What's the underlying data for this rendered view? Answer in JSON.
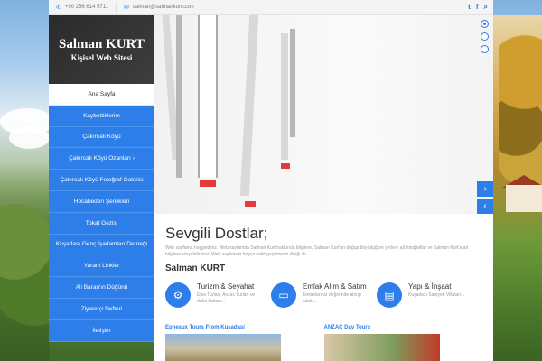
{
  "topbar": {
    "phone": "+90 256 614 5711",
    "email": "salman@salmankurt.com",
    "social_icons": [
      "twitter-icon",
      "facebook-icon",
      "search-icon"
    ]
  },
  "logo": {
    "name": "Salman KURT",
    "subtitle": "Kişisel Web Sitesi"
  },
  "menu": [
    {
      "label": "Ana Sayfa",
      "active": true
    },
    {
      "label": "Kaybettiklerim"
    },
    {
      "label": "Çakırcalı Köyü"
    },
    {
      "label": "Çakırcalı Köyü Ozanları",
      "has_submenu": true
    },
    {
      "label": "Çakırcalı Köyü Fotoğraf Galerisi"
    },
    {
      "label": "Hocabeden Şenlikleri"
    },
    {
      "label": "Tokat Gezisi"
    },
    {
      "label": "Kuşadası Genç İşadamları Derneği"
    },
    {
      "label": "Yararlı Linkler"
    },
    {
      "label": "Ali Baran'ın Düğünü"
    },
    {
      "label": "Ziyaretçi Defteri"
    },
    {
      "label": "İletişim"
    }
  ],
  "content": {
    "title": "Sevgili Dostlar;",
    "intro": "Web sayfama hoşgeldiniz. Web sayfamda Salman Kurt hakkında bilgilere, Salman Kurt'un doğup büyüdüğüm yerlere ait fotoğraflar ve Salman Kurt'a ait bilgilere ulaşabilirsiniz. Web sayfamda hoşça vakit geçirmeniz dileği ile.",
    "subtitle": "Salman KURT",
    "features": [
      {
        "title": "Turizm & Seyahat",
        "desc": "Efes Turları, Anzac Turları ve daha fazlası...",
        "icon": "gears-icon"
      },
      {
        "title": "Emlak Alım & Satım",
        "desc": "Emlaklarınız değerinde alınıp satılır...",
        "icon": "monitor-icon"
      },
      {
        "title": "Yapı & İnşaat",
        "desc": "Kuşadası Samyeri Villaları...",
        "icon": "book-icon"
      }
    ],
    "cards": [
      {
        "title": "Ephesux Tours From Kusadasi"
      },
      {
        "title": "ANZAC Day Tours"
      }
    ]
  },
  "slider": {
    "arrows": [
      "chevron-right-icon",
      "chevron-left-icon"
    ],
    "dots_count": 3
  }
}
